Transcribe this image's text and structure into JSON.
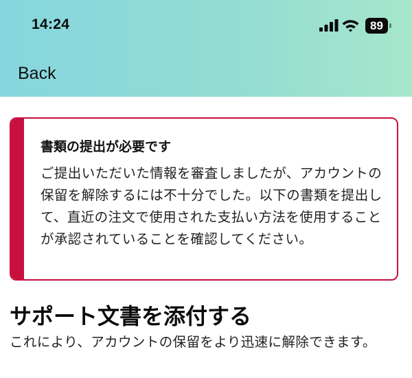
{
  "status_bar": {
    "time": "14:24",
    "battery": "89",
    "signal_icon": "cellular-signal-icon",
    "wifi_icon": "wifi-icon",
    "battery_icon": "battery-icon"
  },
  "nav": {
    "back_label": "Back"
  },
  "alert": {
    "title": "書類の提出が必要です",
    "body": "ご提出いただいた情報を審査しましたが、アカウントの保留を解除するには不十分でした。以下の書類を提出して、直近の注文で使用された支払い方法を使用することが承認されていることを確認してください。",
    "accent_color": "#c8103e"
  },
  "section": {
    "title": "サポート文書を添付する",
    "description": "これにより、アカウントの保留をより迅速に解除できます。"
  }
}
